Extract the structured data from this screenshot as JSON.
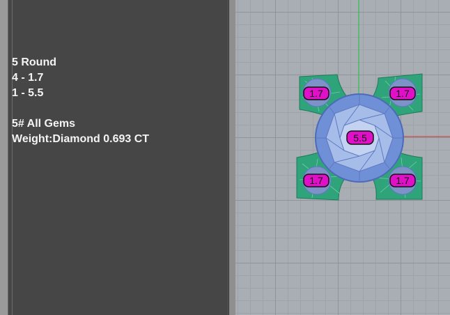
{
  "info": {
    "lines": [
      "5 Round",
      "4 - 1.7",
      "1 - 5.5",
      "",
      "5# All Gems",
      "Weight:Diamond 0.693 CT"
    ]
  },
  "viewport": {
    "gem_labels": {
      "center": "5.5",
      "top_left": "1.7",
      "top_right": "1.7",
      "bottom_left": "1.7",
      "bottom_right": "1.7"
    },
    "colors": {
      "label_fill": "#e010c8",
      "prong_green": "#2fa37a",
      "gem_blue": "#6f8fd6",
      "axis_green": "#18c23a",
      "axis_red": "#d83030"
    }
  }
}
